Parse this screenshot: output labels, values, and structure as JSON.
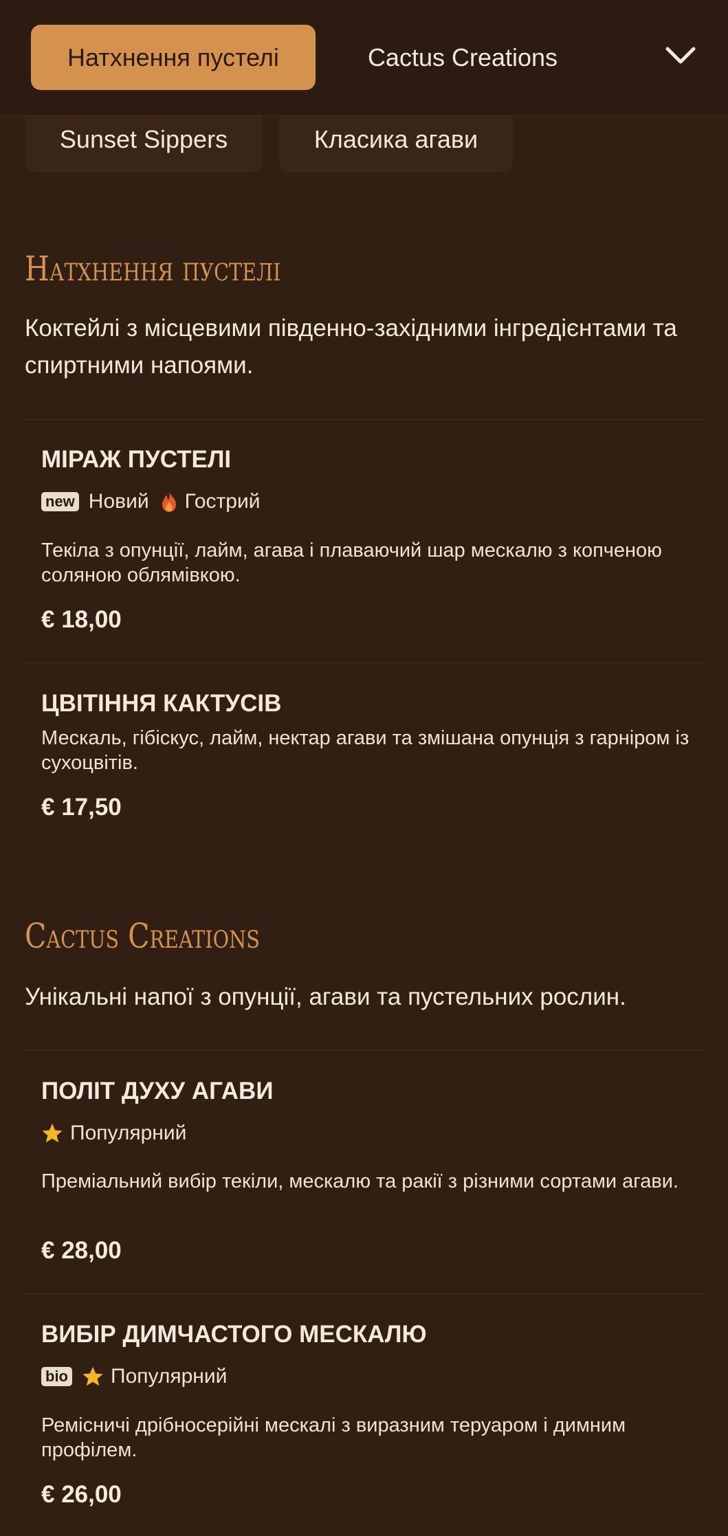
{
  "nav": {
    "tabs": [
      {
        "label": "Натхнення пустелі",
        "active": true
      },
      {
        "label": "Cactus Creations",
        "active": false
      },
      {
        "label": "Sunset Sippers",
        "active": false
      },
      {
        "label": "Класика агави",
        "active": false
      }
    ],
    "dropdown_icon": "chevron-down-icon"
  },
  "sections": [
    {
      "title": "Натхнення пустелі",
      "description": "Коктейлі з місцевими південно-західними інгредієнтами та спиртними напоями.",
      "items": [
        {
          "name": "МІРАЖ ПУСТЕЛІ",
          "badge": "new",
          "tags": [
            "Новий",
            "Гострий"
          ],
          "tag_icons": [
            "fire-icon"
          ],
          "description": "Текіла з опунції, лайм, агава і плаваючий шар мескалю з копченою соляною облямівкою.",
          "price": "€ 18,00"
        },
        {
          "name": "ЦВІТІННЯ КАКТУСІВ",
          "description": "Мескаль, гібіскус, лайм, нектар агави та змішана опунція з гарніром із сухоцвітів.",
          "price": "€ 17,50"
        }
      ]
    },
    {
      "title": "Cactus Creations",
      "description": "Унікальні напої з опунції, агави та пустельних рослин.",
      "items": [
        {
          "name": "ПОЛІТ ДУХУ АГАВИ",
          "tags": [
            "Популярний"
          ],
          "tag_icons": [
            "star-icon"
          ],
          "description": "Преміальний вибір текіли, мескалю та ракії з різними сортами агави.",
          "price": "€ 28,00"
        },
        {
          "name": "ВИБІР ДИМЧАСТОГО МЕСКАЛЮ",
          "badge": "bio",
          "tags": [
            "Популярний"
          ],
          "tag_icons": [
            "star-icon"
          ],
          "description": "Ремісничі дрібносерійні мескалі з виразним теруаром і димним профілем.",
          "price": "€ 26,00"
        }
      ]
    }
  ],
  "colors": {
    "background": "#311f14",
    "accent": "#d4924e",
    "text": "#f3e9dd",
    "star": "#f5b820",
    "fire": "#e8552a"
  }
}
